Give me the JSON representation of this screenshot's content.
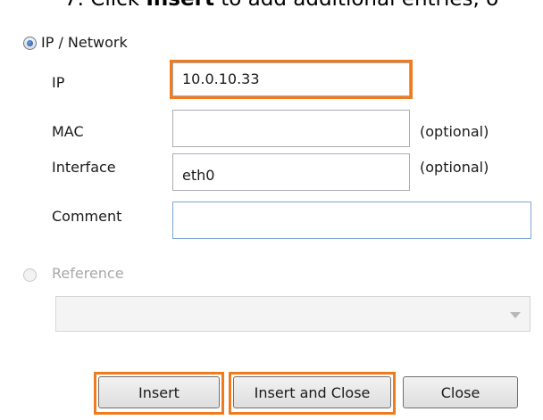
{
  "instruction": {
    "prefix": "7. Click ",
    "bold": "Insert",
    "suffix": " to add additional entries, o"
  },
  "mode_ip": {
    "label": "IP / Network",
    "checked": true
  },
  "fields": {
    "ip": {
      "label": "IP",
      "value": "10.0.10.33"
    },
    "mac": {
      "label": "MAC",
      "value": "",
      "hint": "(optional)"
    },
    "interface": {
      "label": "Interface",
      "value": "eth0",
      "hint": "(optional)"
    },
    "comment": {
      "label": "Comment",
      "value": ""
    }
  },
  "mode_reference": {
    "label": "Reference",
    "checked": false,
    "enabled": false
  },
  "reference_select": {
    "value": ""
  },
  "buttons": {
    "insert": "Insert",
    "insert_close": "Insert and Close",
    "close": "Close"
  },
  "colors": {
    "highlight": "#f07b1f"
  }
}
